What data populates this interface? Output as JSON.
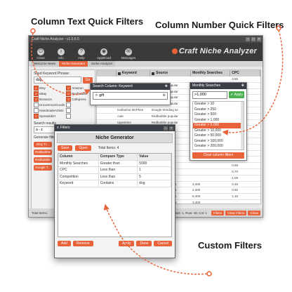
{
  "callouts": {
    "column_text": "Column Text Quick Filters",
    "column_number": "Column Number Quick Filters",
    "custom": "Custom Filters"
  },
  "colors": {
    "accent": "#e8623a",
    "dark": "#3a3f47",
    "apply": "#4caf50"
  },
  "app": {
    "title": "Craft Niche Analyzer - v1.0.6.5",
    "toolbar": [
      {
        "label": "Close",
        "icon": "close-icon"
      },
      {
        "label": "Info",
        "icon": "info-icon"
      },
      {
        "label": "Help",
        "icon": "help-icon"
      },
      {
        "label": "AppBroad",
        "icon": "appbroad-icon"
      },
      {
        "label": "Messages",
        "icon": "messages-icon"
      }
    ],
    "brand": "Craft Niche Analyzer",
    "tabs": [
      "Welcome News",
      "Niche Generator",
      "Niche Analyzer"
    ],
    "left": {
      "seed_label": "Seed Keyword Phrase:",
      "seed_value": "dog",
      "go": "Go",
      "sources": [
        {
          "label": "Etsy",
          "checked": true
        },
        {
          "label": "Amazon",
          "checked": true
        },
        {
          "label": "eBay",
          "checked": true
        },
        {
          "label": "Redbubble",
          "checked": true
        },
        {
          "label": "Bonanza",
          "checked": true
        },
        {
          "label": "Cafepress",
          "checked": true
        },
        {
          "label": "UncommonGoods",
          "checked": false
        },
        {
          "label": "",
          "checked": false
        },
        {
          "label": "HandmadeArtists",
          "checked": false
        },
        {
          "label": "",
          "checked": false
        },
        {
          "label": "Spreadshirt",
          "checked": true
        },
        {
          "label": "",
          "checked": false
        }
      ],
      "search_results_label": "Search results",
      "sort_label": "a - z",
      "generate_label": "Generate filters",
      "gen_buttons": [
        "Etsy Tr...",
        "RedBubble",
        "Redbubble",
        "Google T..."
      ]
    },
    "grid": {
      "columns": [
        "Keyword",
        "Source",
        "Monthly Searches",
        "CPC"
      ],
      "rows": [
        {
          "keyword": "",
          "source": "",
          "searches": "",
          "cpc": "3.85"
        },
        {
          "keyword": "gift",
          "source": "Redbubble popular",
          "searches": "",
          "cpc": "0.25"
        },
        {
          "keyword": "",
          "source": "Redbubble popular",
          "searches": "",
          "cpc": "0.48"
        },
        {
          "keyword": "",
          "source": "Redbubble popular",
          "searches": "",
          "cpc": "1.16"
        },
        {
          "keyword": "cool",
          "source": "Redbubble popular",
          "searches": "",
          "cpc": "1.45"
        },
        {
          "keyword": "Katharine McPhee",
          "source": "Google trending se",
          "searches": "",
          "cpc": "0.28"
        },
        {
          "keyword": "cute",
          "source": "Redbubble popular",
          "searches": "",
          "cpc": "0.31"
        },
        {
          "keyword": "tapestries",
          "source": "Redbubble popular",
          "searches": "",
          "cpc": "1.21"
        },
        {
          "keyword": "",
          "source": "",
          "searches": "",
          "cpc": "0.85"
        },
        {
          "keyword": "",
          "source": "",
          "searches": "",
          "cpc": "1.38"
        },
        {
          "keyword": "",
          "source": "",
          "searches": "",
          "cpc": "0.92"
        },
        {
          "keyword": "",
          "source": "",
          "searches": "",
          "cpc": "0.47"
        },
        {
          "keyword": "",
          "source": "",
          "searches": "",
          "cpc": "0.73"
        },
        {
          "keyword": "",
          "source": "",
          "searches": "",
          "cpc": "1.74"
        },
        {
          "keyword": "",
          "source": "",
          "searches": "",
          "cpc": "0.69"
        },
        {
          "keyword": "",
          "source": "",
          "searches": "",
          "cpc": "0.70"
        },
        {
          "keyword": "",
          "source": "",
          "searches": "",
          "cpc": "1.09"
        },
        {
          "keyword": "",
          "source": "trending searches",
          "searches": "3,400",
          "cpc": "0.46"
        },
        {
          "keyword": "",
          "source": "trending searches",
          "searches": "2,400",
          "cpc": "0.92"
        },
        {
          "keyword": "",
          "source": "trending searches",
          "searches": "5,400",
          "cpc": "1.15"
        },
        {
          "keyword": "",
          "source": "trending searches",
          "searches": "3,400",
          "cpc": ""
        }
      ]
    },
    "status": {
      "left": "Total Items:",
      "right": "Selected rows: 1, Row: 49, Col: 1",
      "buttons": [
        "Filters",
        "Clear Filters",
        "Close"
      ]
    }
  },
  "search_popup": {
    "title": "Search Column: Keyword",
    "value": "gift"
  },
  "num_popup": {
    "title": "Monthly Searches",
    "value": ">1,000",
    "apply": "Apply",
    "options": [
      "Greater > 10",
      "Greater > 250",
      "Greater > 500",
      "Greater > 1,000",
      "Greater > 5,000",
      "Greater > 10,000",
      "Greater > 50,000",
      "Greater > 100,000",
      "Greater > 200,000"
    ],
    "selected": "Greater > 5,000",
    "clear": "Clear column filters"
  },
  "filters_win": {
    "title": "Filters",
    "heading": "Niche Generator",
    "save": "Save",
    "open": "Open",
    "total": "Total Items: 4",
    "columns": [
      "Column",
      "Compare Type",
      "Value"
    ],
    "rows": [
      {
        "column": "Monthly Searches",
        "compare": "Greater than",
        "value": "5000"
      },
      {
        "column": "CPC",
        "compare": "Less than",
        "value": "1"
      },
      {
        "column": "Competition",
        "compare": "Less than",
        "value": "5"
      },
      {
        "column": "Keyword",
        "compare": "Contains",
        "value": "dog"
      }
    ],
    "add": "Add",
    "remove": "Remove",
    "apply": "Apply",
    "done": "Done",
    "cancel": "Cancel"
  }
}
